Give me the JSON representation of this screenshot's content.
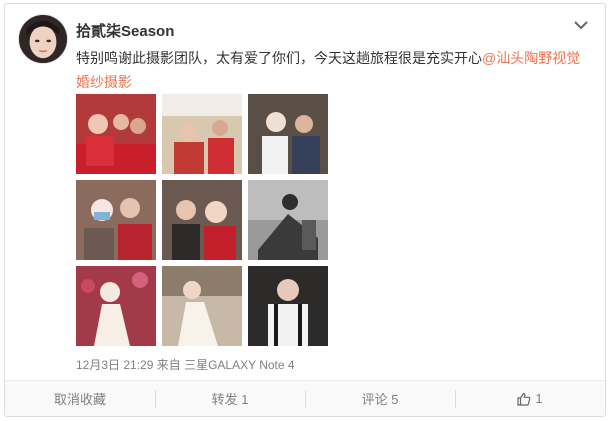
{
  "post": {
    "username": "拾貳柒Season",
    "text": "特别鸣谢此摄影团队，太有爱了你们，今天这趟旅程很是充实开心",
    "mention": "@汕头陶野视觉婚纱摄影",
    "timestamp": "12月3日 21:29",
    "source": "来自 三星GALAXY Note 4",
    "photos": [
      {
        "bg": "#b33a3a",
        "accent": "#f2c6b5"
      },
      {
        "bg": "#d9c8b0",
        "accent": "#c23a34"
      },
      {
        "bg": "#5a4f46",
        "accent": "#f0e0d4"
      },
      {
        "bg": "#8a6b5e",
        "accent": "#f6e6e1"
      },
      {
        "bg": "#6b5a52",
        "accent": "#c21f2a"
      },
      {
        "bg": "#9a9a9a",
        "accent": "#2e2e2e"
      },
      {
        "bg": "#a23a4a",
        "accent": "#f4e9e0"
      },
      {
        "bg": "#c8b8a6",
        "accent": "#f7f2ea"
      },
      {
        "bg": "#2d2a2a",
        "accent": "#f2f2f2"
      }
    ]
  },
  "actions": {
    "unfavorite": "取消收藏",
    "repost": "转发 1",
    "comment": "评论 5",
    "like_count": "1"
  },
  "icons": {
    "menu": "chevron-down-icon",
    "like": "thumbs-up-icon"
  }
}
